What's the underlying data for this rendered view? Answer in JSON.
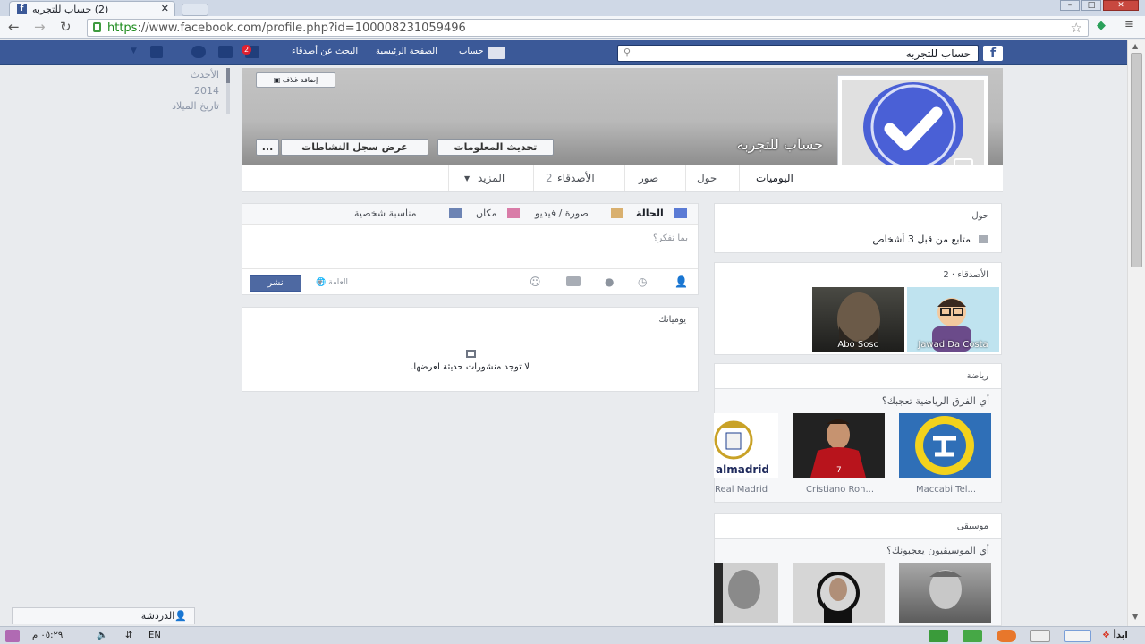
{
  "browser": {
    "tab_title": "(2) حساب للتجربه",
    "url_https": "https",
    "url_rest": "://www.facebook.com/profile.php?id=100008231059496"
  },
  "fb_header": {
    "search_value": "حساب للتجربه",
    "profile_link": "حساب",
    "home_link": "الصفحة الرئيسية",
    "find_friends_link": "البحث عن أصدقاء",
    "friend_requests_count": "2"
  },
  "timeline_nav": [
    "الأحدث",
    "2014",
    "تاريخ الميلاد"
  ],
  "profile": {
    "name": "حساب للتجربه",
    "add_cover_label": "إضافة غلاف",
    "update_info_label": "تحديث المعلومات",
    "activity_log_label": "عرض سجل النشاطات",
    "more_label": "...",
    "tabs": {
      "timeline": "اليوميات",
      "about": "حول",
      "photos": "صور",
      "friends": "الأصدقاء",
      "friends_count": "2",
      "more": "المزيد"
    }
  },
  "composer": {
    "status": "الحالة",
    "photo_video": "صورة / فيديو",
    "place": "مكان",
    "life_event": "مناسبة شخصية",
    "placeholder": "بما تفكر؟",
    "audience": "العامة",
    "post_button": "نشر"
  },
  "timeline_box": {
    "header": "يومياتك",
    "empty": "لا توجد منشورات حديثة لعرضها."
  },
  "about_box": {
    "header": "حول",
    "followed_by": "متابع من قبل 3 أشخاص"
  },
  "friends_box": {
    "header": "الأصدقاء",
    "count": "2",
    "friends": [
      "Jawad Da Costa",
      "Abo Soso"
    ]
  },
  "sports_box": {
    "header": "رياضة",
    "question": "أي الفرق الرياضية تعجبك؟",
    "teams": [
      "Maccabi Tel...",
      "Cristiano Ron...",
      "Real Madrid"
    ],
    "real_madrid_logo_text": "almadrid"
  },
  "music_box": {
    "header": "موسيقى",
    "question": "أي الموسيقيون يعجبونك؟"
  },
  "chat": {
    "label": "الدردشة"
  },
  "taskbar": {
    "start": "ابدأ",
    "lang": "EN",
    "clock": "٠٥:٢٩ م"
  }
}
